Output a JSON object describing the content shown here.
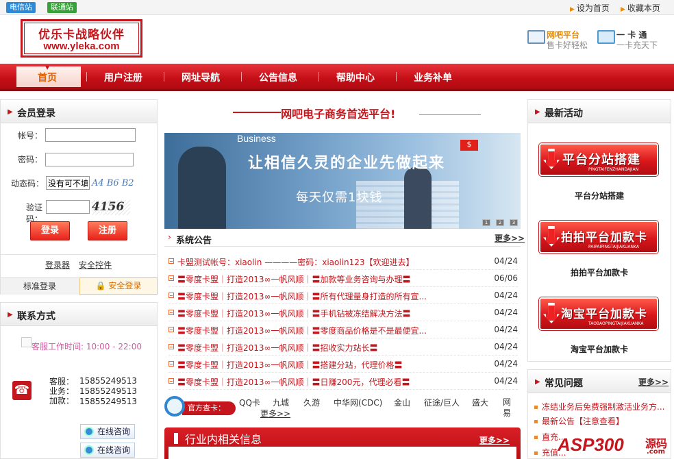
{
  "top_bar": {
    "tags": [
      "电信站",
      "联通站"
    ],
    "links": [
      "设为首页",
      "收藏本页"
    ]
  },
  "header": {
    "logo_line1": "优乐卡战略伙伴",
    "logo_line2": "www.yleka.com",
    "badges": [
      {
        "title": "网吧平台",
        "sub": "售卡好轻松"
      },
      {
        "title": "一 卡 通",
        "sub": "一卡充天下"
      }
    ]
  },
  "nav": {
    "items": [
      "首页",
      "用户注册",
      "网址导航",
      "公告信息",
      "帮助中心",
      "业务补单"
    ],
    "active": "首页"
  },
  "login": {
    "title": "会员登录",
    "labels": [
      "帐号：",
      "密码：",
      "动态码：",
      "验证码："
    ],
    "dynamic_value": "没有可不填",
    "dynamic_hint": "A4 B6 B2",
    "captcha": "4156",
    "login_btn": "登录",
    "register_btn": "注册",
    "links": [
      "登录器",
      "安全控件"
    ],
    "tabs": [
      "标准登录",
      "安全登录"
    ]
  },
  "contact": {
    "title": "联系方式",
    "hours": "客服工作时间: 10:00 - 22:00",
    "rows": [
      {
        "label": "客服：",
        "value": "15855249513"
      },
      {
        "label": "业务：",
        "value": "15855249513"
      },
      {
        "label": "加款：",
        "value": "15855249513"
      }
    ],
    "consult": [
      "在线咨询",
      "在线咨询"
    ]
  },
  "center": {
    "slogan": "网吧电子商务首选平台!",
    "banner": {
      "word": "Business",
      "headline": "让相信久灵的企业先做起来",
      "sub": "每天仅需1块钱",
      "flag": "$",
      "dots": [
        "1",
        "2",
        "3"
      ]
    },
    "notice": {
      "title": "系统公告",
      "more": "更多>>",
      "items": [
        {
          "text": "卡盟测试帐号：xiaolin ————密码：xiaolin123【欢迎进去】",
          "date": "04/24"
        },
        {
          "text": "〓零度卡盟｜打造2013∞一帆风顺｜〓加款等业务咨询与办理〓",
          "date": "06/06"
        },
        {
          "text": "〓零度卡盟｜打造2013∞一帆风顺｜〓所有代理量身打造的所有宣...",
          "date": "04/24"
        },
        {
          "text": "〓零度卡盟｜打造2013∞一帆风顺｜〓手机钻被冻结解决方法〓",
          "date": "04/24"
        },
        {
          "text": "〓零度卡盟｜打造2013∞一帆风顺｜〓零度商品价格是不是最便宜...",
          "date": "04/24"
        },
        {
          "text": "〓零度卡盟｜打造2013∞一帆风顺｜〓招收实力站长〓",
          "date": "04/24"
        },
        {
          "text": "〓零度卡盟｜打造2013∞一帆风顺｜〓搭建分站，代理价格〓",
          "date": "04/24"
        },
        {
          "text": "〓零度卡盟｜打造2013∞一帆风顺｜〓日赚200元，代理必看〓",
          "date": "04/24"
        }
      ]
    },
    "query": {
      "tag": "官方查卡：",
      "links": [
        "QQ卡",
        "九城",
        "久游",
        "中华网(CDC)",
        "金山",
        "征途/巨人",
        "盛大",
        "网易"
      ],
      "more": "更多>>"
    },
    "industry": {
      "title": "行业内相关信息",
      "more": "更多>>"
    }
  },
  "right": {
    "activity_title": "最新活动",
    "promos": [
      {
        "big": "平台分站搭建",
        "small": "PINGTAIFENZHANDAJIAN",
        "caption": "平台分站搭建"
      },
      {
        "big": "拍拍平台加款卡",
        "small": "PAIPAIPINGTAIJIAKUANKA",
        "caption": "拍拍平台加款卡"
      },
      {
        "big": "淘宝平台加款卡",
        "small": "TAOBAOPINGTAIJIAKUANKA",
        "caption": "淘宝平台加款卡"
      }
    ],
    "faq_title": "常见问题",
    "faq_more": "更多>>",
    "faq": [
      "冻结业务后免费强制激活业务方...",
      "最新公告【注意查看】",
      "直充...",
      "充值..."
    ]
  },
  "watermark": {
    "brand": "ASP300",
    "suffix": "源码",
    "domain": ".com"
  },
  "colors": {
    "brand_red": "#c4161c",
    "nav_red": "#d91f26",
    "accent_orange": "#e98a00"
  }
}
